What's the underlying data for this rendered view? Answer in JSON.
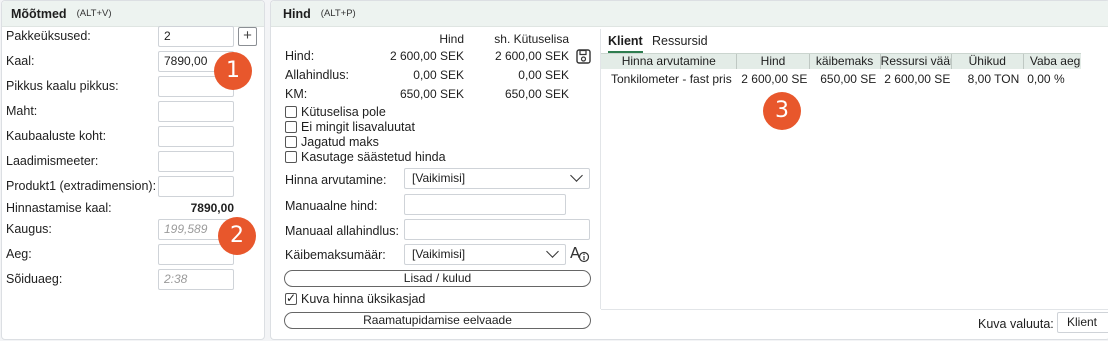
{
  "mootmed": {
    "title": "Mõõtmed",
    "shortcut": "(ALT+V)",
    "fields": [
      {
        "label": "Pakkeüksused:",
        "value": "2"
      },
      {
        "label": "Kaal:",
        "value": "7890,00"
      },
      {
        "label": "Pikkus kaalu pikkus:",
        "value": ""
      },
      {
        "label": "Maht:",
        "value": ""
      },
      {
        "label": "Kaubaaluste koht:",
        "value": ""
      },
      {
        "label": "Laadimismeeter:",
        "value": ""
      },
      {
        "label": "Produkt1 (extradimension):",
        "value": ""
      }
    ],
    "hinnastamise_label": "Hinnastamise kaal:",
    "hinnastamise_value": "7890,00",
    "kaugus_label": "Kaugus:",
    "kaugus_value": "199,589",
    "aeg_label": "Aeg:",
    "aeg_value": "",
    "soiduaeg_label": "Sõiduaeg:",
    "soiduaeg_value": "2:38",
    "plus_symbol": "+"
  },
  "hind": {
    "title": "Hind",
    "shortcut": "(ALT+P)",
    "col_hind": "Hind",
    "col_kutuselisa": "sh. Kütuselisa",
    "rows": [
      {
        "label": "Hind:",
        "hind": "2 600,00 SEK",
        "kutus": "2 600,00 SEK"
      },
      {
        "label": "Allahindlus:",
        "hind": "0,00 SEK",
        "kutus": "0,00 SEK"
      },
      {
        "label": "KM:",
        "hind": "650,00 SEK",
        "kutus": "650,00 SEK"
      }
    ],
    "checkboxes": [
      {
        "label": "Kütuselisa pole",
        "checked": false
      },
      {
        "label": "Ei mingit lisavaluutat",
        "checked": false
      },
      {
        "label": "Jagatud maks",
        "checked": false
      },
      {
        "label": "Kasutage säästetud hinda",
        "checked": false
      }
    ],
    "hinna_arvutamine_label": "Hinna arvutamine:",
    "hinna_arvutamine_value": "[Vaikimisi]",
    "manuaalne_hind_label": "Manuaalne hind:",
    "manuaal_allahindlus_label": "Manuaal allahindlus:",
    "kaibemaksumaar_label": "Käibemaksumäär:",
    "kaibemaksumaar_value": "[Vaikimisi]",
    "lisad_button": "Lisad / kulud",
    "kuva_checkbox": "Kuva hinna üksikasjad",
    "raamatupidamise_button": "Raamatupidamise eelvaade",
    "badge_3": "3"
  },
  "klient_panel": {
    "tabs": [
      "Klient",
      "Ressursid"
    ],
    "columns": [
      "Hinna arvutamine",
      "Hind",
      "käibemaks",
      "Ressursi väär",
      "Ühikud",
      "Vaba aeg"
    ],
    "rows": [
      [
        "Tonkilometer - fast pris",
        "2 600,00 SE",
        "650,00 SE",
        "2 600,00 SE",
        "8,00 TON",
        "0,00 %"
      ]
    ],
    "kuva_valuuta_label": "Kuva valuuta:",
    "kuva_valuuta_value": "Klient"
  },
  "badges": {
    "one": "1",
    "two": "2"
  },
  "colors": {
    "badge": "#e8572c",
    "header_bg": "#edf3f0",
    "tab_underline": "#2e7d4f"
  }
}
